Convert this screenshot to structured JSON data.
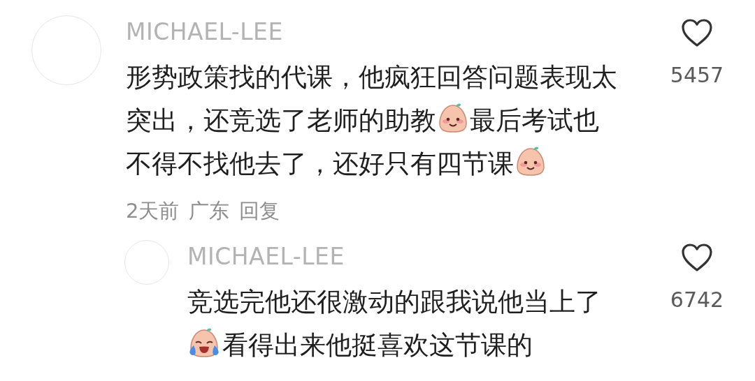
{
  "comments": [
    {
      "username": "MICHAEL-LEE",
      "likes": "5457",
      "kind": "comment",
      "lines": [
        [
          {
            "kind": "text",
            "text": "形势政策找的代课，他疯狂回答问题表现太"
          }
        ],
        [
          {
            "kind": "text",
            "text": "突出，还竞选了老师的助教"
          },
          {
            "kind": "smile"
          },
          {
            "kind": "text",
            "text": "最后考试也"
          }
        ],
        [
          {
            "kind": "text",
            "text": "不得不找他去了，还好只有四节课"
          },
          {
            "kind": "smile"
          }
        ]
      ],
      "meta": [
        "2天前",
        "广东",
        "回复"
      ]
    },
    {
      "username": "MICHAEL-LEE",
      "likes": "6742",
      "kind": "reply",
      "lines": [
        [
          {
            "kind": "text",
            "text": "竞选完他还很激动的跟我说他当上了"
          }
        ],
        [
          {
            "kind": "laugh"
          },
          {
            "kind": "text",
            "text": "看得出来他挺喜欢这节课的"
          }
        ]
      ]
    }
  ]
}
